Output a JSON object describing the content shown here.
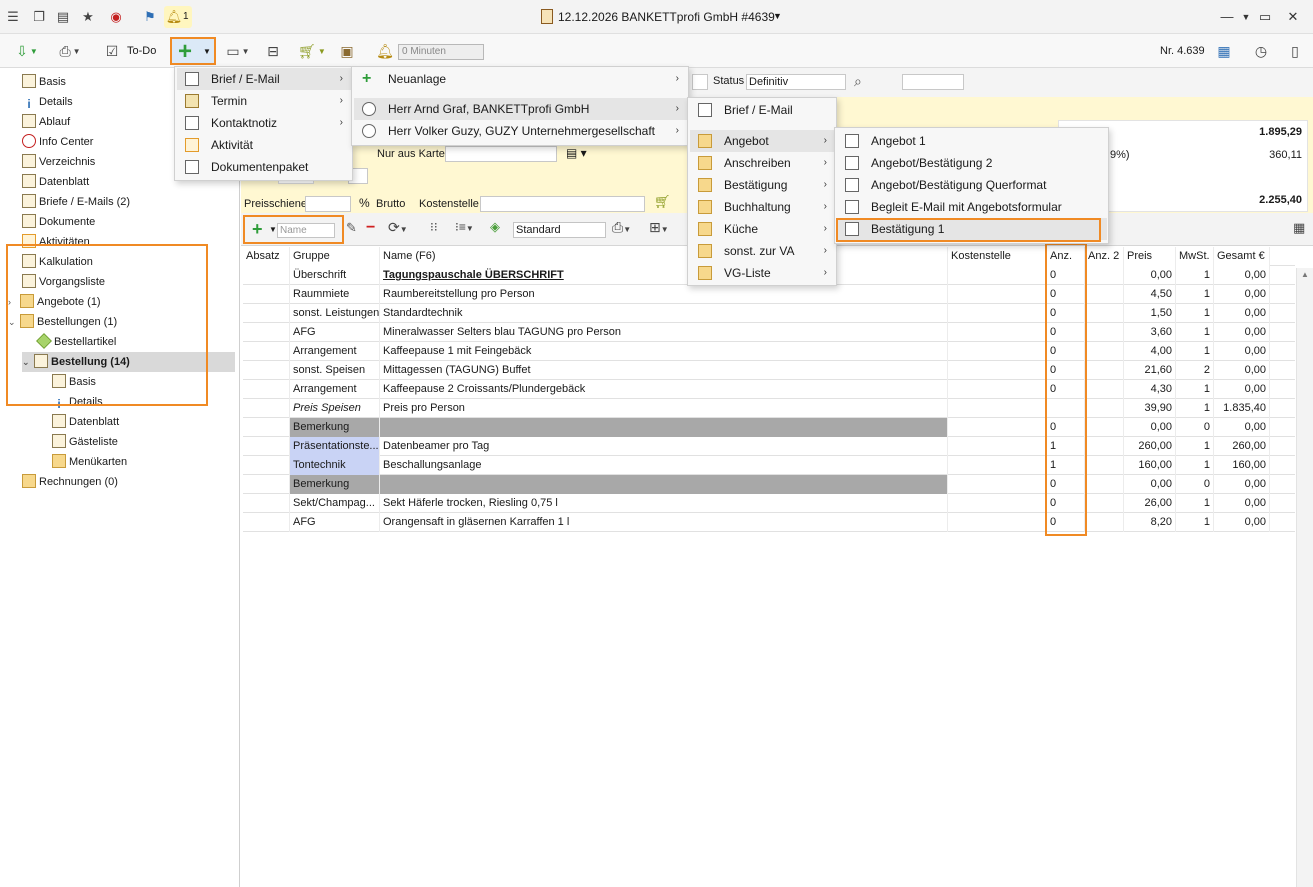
{
  "window": {
    "title": "12.12.2026 BANKETTprofi GmbH #4639",
    "notification_count": "1"
  },
  "toolbar": {
    "todo_label": "To-Do",
    "minutes_placeholder": "0 Minuten",
    "nr_label": "Nr. 4.639"
  },
  "sidebar": {
    "items": [
      {
        "label": "Basis"
      },
      {
        "label": "Details"
      },
      {
        "label": "Ablauf"
      },
      {
        "label": "Info Center"
      },
      {
        "label": "Verzeichnis"
      },
      {
        "label": "Datenblatt"
      },
      {
        "label": "Briefe / E-Mails (2)"
      },
      {
        "label": "Dokumente"
      },
      {
        "label": "Aktivitäten"
      },
      {
        "label": "Kalkulation"
      },
      {
        "label": "Vorgangsliste"
      },
      {
        "label": "Angebote (1)"
      },
      {
        "label": "Bestellungen (1)"
      },
      {
        "label": "Bestellartikel"
      },
      {
        "label": "Bestellung (14)"
      },
      {
        "label": "Basis"
      },
      {
        "label": "Details"
      },
      {
        "label": "Datenblatt"
      },
      {
        "label": "Gästeliste"
      },
      {
        "label": "Menükarten"
      },
      {
        "label": "Rechnungen (0)"
      }
    ]
  },
  "form": {
    "status_label": "Status",
    "status_value": "Definitiv",
    "nur_aus_karte": "Nur aus Karte",
    "preisschiene_label": "Preisschiene VK",
    "brutto_label": "Brutto",
    "kostenstelle_label": "Kostenstelle",
    "standard_value": "Standard",
    "name_placeholder": "Name"
  },
  "summary": {
    "total1": "1.895,29",
    "vat_label": "9%)",
    "vat_value": "360,11",
    "total2": "2.255,40"
  },
  "grid": {
    "headers": [
      "Absatz",
      "Gruppe",
      "Name (F6)",
      "Kostenstelle",
      "Anz.",
      "Anz. 2",
      "Preis",
      "MwSt.",
      "Gesamt €"
    ],
    "rows": [
      {
        "gruppe": "Überschrift",
        "name": "Tagungspauschale ÜBERSCHRIFT",
        "anz": "0",
        "preis": "0,00",
        "mwst": "1",
        "gesamt": "0,00"
      },
      {
        "gruppe": "Raummiete",
        "name": "Raumbereitstellung pro Person",
        "anz": "0",
        "preis": "4,50",
        "mwst": "1",
        "gesamt": "0,00"
      },
      {
        "gruppe": "sonst. Leistungen",
        "name": "Standardtechnik",
        "anz": "0",
        "preis": "1,50",
        "mwst": "1",
        "gesamt": "0,00"
      },
      {
        "gruppe": "AFG",
        "name": "Mineralwasser Selters blau TAGUNG pro Person",
        "anz": "0",
        "preis": "3,60",
        "mwst": "1",
        "gesamt": "0,00"
      },
      {
        "gruppe": "Arrangement",
        "name": "Kaffeepause 1 mit Feingebäck",
        "anz": "0",
        "preis": "4,00",
        "mwst": "1",
        "gesamt": "0,00"
      },
      {
        "gruppe": "sonst. Speisen",
        "name": "Mittagessen (TAGUNG) Buffet",
        "anz": "0",
        "preis": "21,60",
        "mwst": "2",
        "gesamt": "0,00"
      },
      {
        "gruppe": "Arrangement",
        "name": "Kaffeepause 2 Croissants/Plundergebäck",
        "anz": "0",
        "preis": "4,30",
        "mwst": "1",
        "gesamt": "0,00"
      },
      {
        "gruppe": "Preis Speisen",
        "name": "Preis pro Person",
        "anz": "",
        "preis": "39,90",
        "mwst": "1",
        "gesamt": "1.835,40"
      },
      {
        "gruppe": "Bemerkung",
        "name": "",
        "anz": "0",
        "preis": "0,00",
        "mwst": "0",
        "gesamt": "0,00"
      },
      {
        "gruppe": "Präsentationste...",
        "name": "Datenbeamer pro Tag",
        "anz": "1",
        "preis": "260,00",
        "mwst": "1",
        "gesamt": "260,00"
      },
      {
        "gruppe": "Tontechnik",
        "name": "Beschallungsanlage",
        "anz": "1",
        "preis": "160,00",
        "mwst": "1",
        "gesamt": "160,00"
      },
      {
        "gruppe": "Bemerkung",
        "name": "",
        "anz": "0",
        "preis": "0,00",
        "mwst": "0",
        "gesamt": "0,00"
      },
      {
        "gruppe": "Sekt/Champag...",
        "name": "Sekt Häferle trocken, Riesling 0,75 l",
        "anz": "0",
        "preis": "26,00",
        "mwst": "1",
        "gesamt": "0,00"
      },
      {
        "gruppe": "AFG",
        "name": "Orangensaft in gläsernen Karraffen 1 l",
        "anz": "0",
        "preis": "8,20",
        "mwst": "1",
        "gesamt": "0,00"
      }
    ]
  },
  "menu1": {
    "items": [
      {
        "label": "Brief / E-Mail"
      },
      {
        "label": "Termin"
      },
      {
        "label": "Kontaktnotiz"
      },
      {
        "label": "Aktivität"
      },
      {
        "label": "Dokumentenpaket"
      }
    ]
  },
  "menu2": {
    "items": [
      {
        "label": "Neuanlage"
      },
      {
        "label": "Herr Arnd Graf, BANKETTprofi GmbH"
      },
      {
        "label": "Herr Volker Guzy, GUZY Unternehmergesellschaft"
      }
    ]
  },
  "menu3": {
    "items": [
      {
        "label": "Brief / E-Mail"
      },
      {
        "label": "Angebot"
      },
      {
        "label": "Anschreiben"
      },
      {
        "label": "Bestätigung"
      },
      {
        "label": "Buchhaltung"
      },
      {
        "label": "Küche"
      },
      {
        "label": "sonst. zur VA"
      },
      {
        "label": "VG-Liste"
      }
    ]
  },
  "menu4": {
    "items": [
      {
        "label": "Angebot 1"
      },
      {
        "label": "Angebot/Bestätigung 2"
      },
      {
        "label": "Angebot/Bestätigung Querformat"
      },
      {
        "label": "Begleit E-Mail mit Angebotsformular"
      },
      {
        "label": "Bestätigung 1"
      }
    ]
  }
}
